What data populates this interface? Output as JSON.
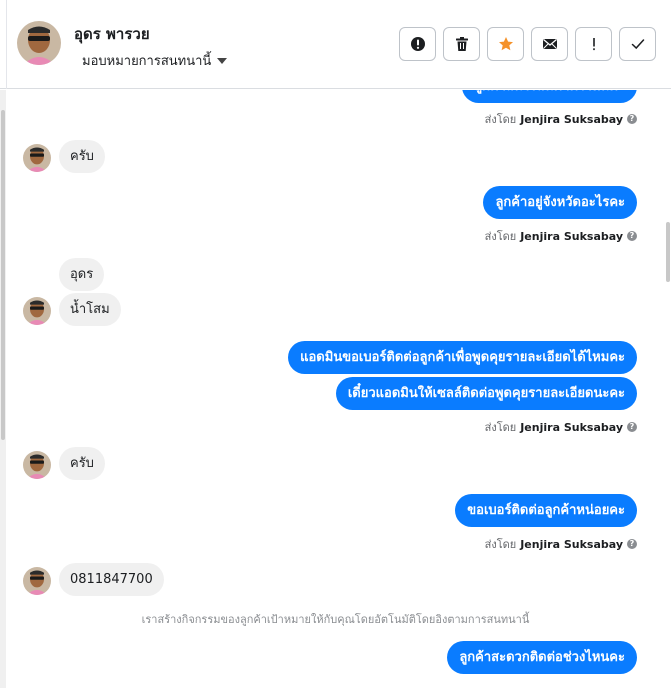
{
  "contact": {
    "name": "อุดร พารวย",
    "assign_label": "มอบหมายการสนทนานี้"
  },
  "toolbar": {
    "buttons": [
      {
        "icon": "alert-circle-icon",
        "label": "!"
      },
      {
        "icon": "trash-icon"
      },
      {
        "icon": "star-icon",
        "color": "#f5922a"
      },
      {
        "icon": "envelope-icon"
      },
      {
        "icon": "exclamation-icon",
        "label": "!"
      },
      {
        "icon": "check-icon"
      }
    ]
  },
  "sent_by": {
    "prefix": "ส่งโดย",
    "agent": "Jenjira Suksabay"
  },
  "messages": [
    {
      "dir": "out",
      "text": "ลูกค้าสนใจสินค้าตัวไหนคะ"
    },
    {
      "dir": "in",
      "text": "ครับ"
    },
    {
      "dir": "out",
      "text": "ลูกค้าอยู่จังหวัดอะไรคะ"
    },
    {
      "dir": "in",
      "text": "อุดร"
    },
    {
      "dir": "in",
      "text": "น้ำโสม"
    },
    {
      "dir": "out",
      "text": "แอดมินขอเบอร์ติดต่อลูกค้าเพื่อพูดคุยรายละเอียดได้ไหมคะ"
    },
    {
      "dir": "out",
      "text": "เดี๋ยวแอดมินให้เซลล์ติดต่อพูดคุยรายละเอียดนะคะ"
    },
    {
      "dir": "in",
      "text": "ครับ"
    },
    {
      "dir": "out",
      "text": "ขอเบอร์ติดต่อลูกค้าหน่อยคะ"
    },
    {
      "dir": "in",
      "text": "0811847700"
    },
    {
      "dir": "out",
      "text": "ลูกค้าสะดวกติดต่อช่วงไหนคะ"
    }
  ],
  "system_note": "เราสร้างกิจกรรมของลูกค้าเป้าหมายให้กับคุณโดยอัตโนมัติโดยอิงตามการสนทนานี้",
  "colors": {
    "outgoing_bubble": "#0a7cff",
    "incoming_bubble": "#f0f0f0",
    "star": "#f5922a"
  }
}
